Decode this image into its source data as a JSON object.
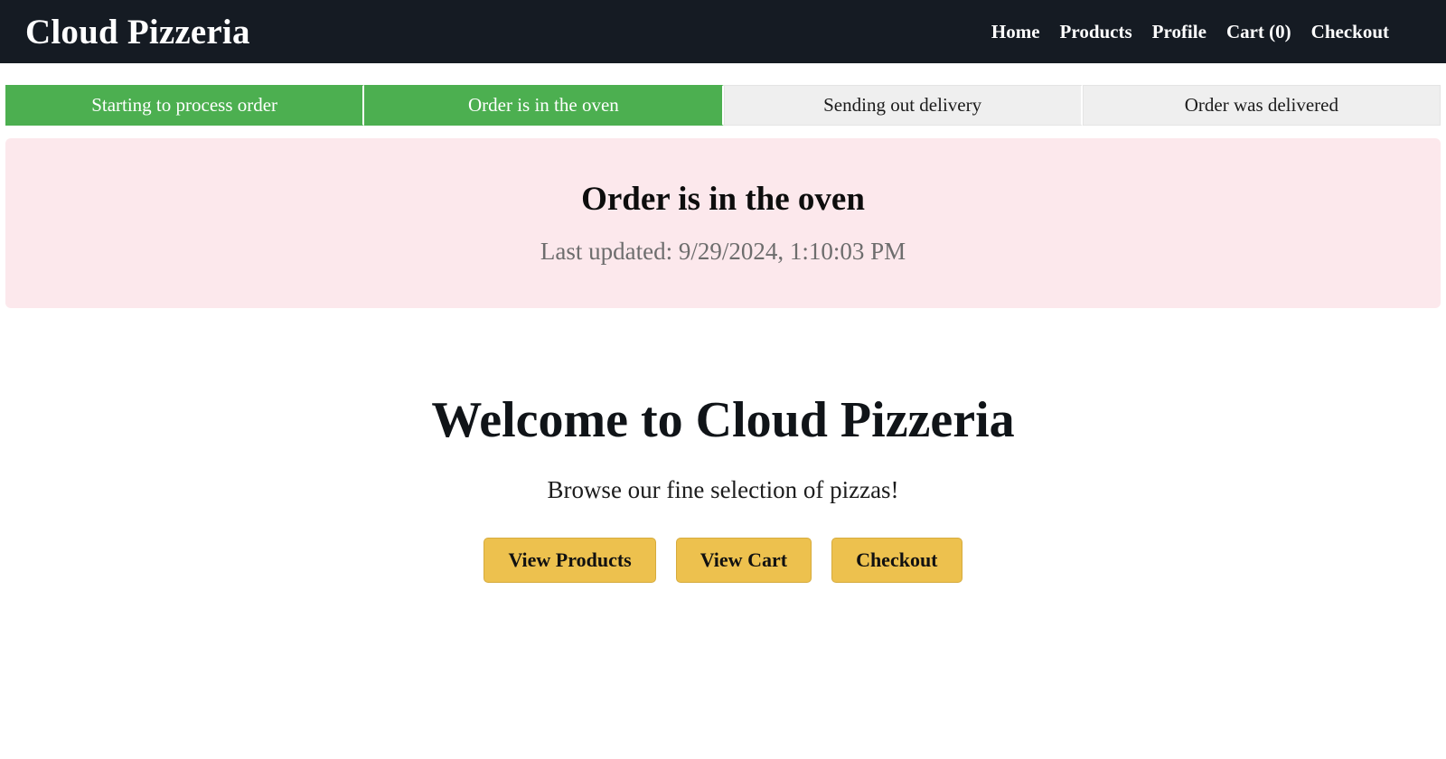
{
  "header": {
    "brand": "Cloud Pizzeria",
    "nav": [
      {
        "label": "Home",
        "name": "nav-link-home"
      },
      {
        "label": "Products",
        "name": "nav-link-products"
      },
      {
        "label": "Profile",
        "name": "nav-link-profile"
      },
      {
        "label": "Cart (0)",
        "name": "nav-link-cart"
      },
      {
        "label": "Checkout",
        "name": "nav-link-checkout"
      }
    ],
    "cart_count": 0,
    "background_color": "#151b23",
    "text_color": "#ffffff"
  },
  "order_progress": {
    "steps": [
      {
        "label": "Starting to process order",
        "state": "active"
      },
      {
        "label": "Order is in the oven",
        "state": "active"
      },
      {
        "label": "Sending out delivery",
        "state": "inactive"
      },
      {
        "label": "Order was delivered",
        "state": "inactive"
      }
    ],
    "active_color": "#4caf50",
    "inactive_color": "#efefef",
    "current_step_index": 1,
    "total_steps": 4
  },
  "status_banner": {
    "title": "Order is in the oven",
    "last_updated": "Last updated: 9/29/2024, 1:10:03 PM",
    "background_color": "#fce8ec",
    "title_color": "#0d0d0d",
    "timestamp_color": "#6d6d6d"
  },
  "hero": {
    "title": "Welcome to Cloud Pizzeria",
    "subtitle": "Browse our fine selection of pizzas!",
    "buttons": [
      {
        "label": "View Products",
        "name": "view-products-button"
      },
      {
        "label": "View Cart",
        "name": "view-cart-button"
      },
      {
        "label": "Checkout",
        "name": "checkout-button"
      }
    ],
    "button_color": "#edc14e",
    "button_border_color": "#d6ab3d"
  }
}
